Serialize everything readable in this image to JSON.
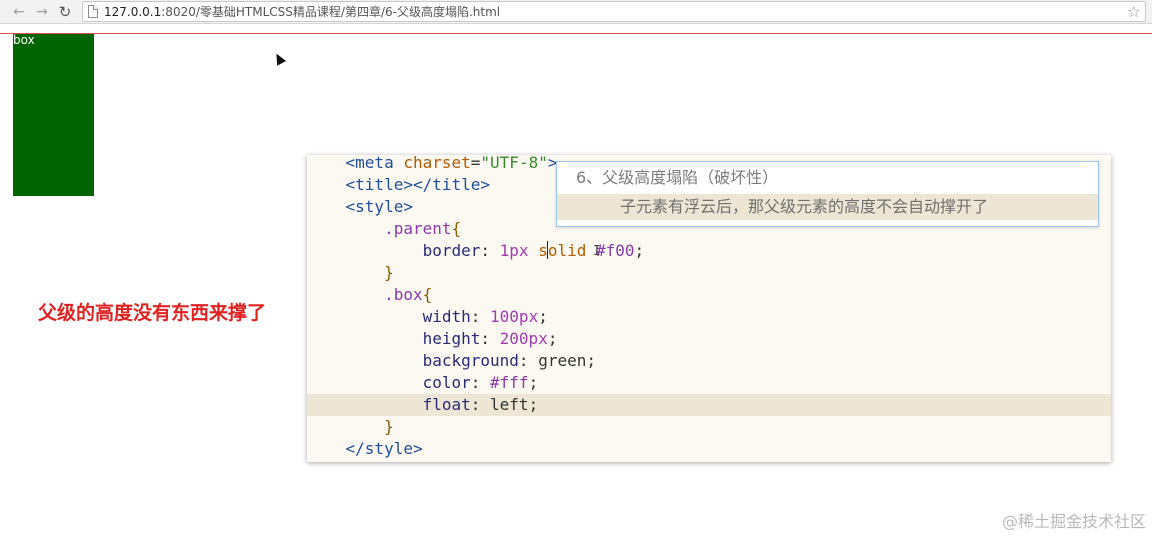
{
  "browser": {
    "url_host": "127.0.0.1",
    "url_path": ":8020/零基础HTMLCSS精品课程/第四章/6-父级高度塌陷.html",
    "icons": {
      "back": "back-arrow-icon",
      "forward": "forward-arrow-icon",
      "reload": "reload-icon",
      "page": "page-icon",
      "bookmark": "star-icon"
    }
  },
  "page": {
    "box_label": "box",
    "box_color": "#006400",
    "parent_border_color": "#ff0000"
  },
  "annotation": {
    "text": "父级的高度没有东西来撑了",
    "color": "#e02222"
  },
  "editor": {
    "lines": [
      {
        "indent": "    ",
        "parts": [
          [
            "tag",
            "<meta "
          ],
          [
            "attr",
            "charset"
          ],
          [
            "plain",
            "="
          ],
          [
            "str",
            "\"UTF-8\""
          ],
          [
            "tag",
            ">"
          ]
        ]
      },
      {
        "indent": "    ",
        "parts": [
          [
            "tag",
            "<title></title>"
          ]
        ]
      },
      {
        "indent": "    ",
        "parts": [
          [
            "tag",
            "<style>"
          ]
        ]
      },
      {
        "indent": "        ",
        "parts": [
          [
            "sel",
            ".parent"
          ],
          [
            "punct",
            "{"
          ]
        ]
      },
      {
        "indent": "            ",
        "parts": [
          [
            "prop",
            "border"
          ],
          [
            "plain",
            ": "
          ],
          [
            "num",
            "1px"
          ],
          [
            "plain",
            " "
          ],
          [
            "kw",
            "solid"
          ],
          [
            "plain",
            " "
          ],
          [
            "sel",
            "#f00"
          ],
          [
            "plain",
            ";"
          ]
        ]
      },
      {
        "indent": "        ",
        "parts": [
          [
            "punct",
            "}"
          ]
        ]
      },
      {
        "indent": "        ",
        "parts": [
          [
            "sel",
            ".box"
          ],
          [
            "punct",
            "{"
          ]
        ]
      },
      {
        "indent": "            ",
        "parts": [
          [
            "prop",
            "width"
          ],
          [
            "plain",
            ": "
          ],
          [
            "num",
            "100px"
          ],
          [
            "plain",
            ";"
          ]
        ]
      },
      {
        "indent": "            ",
        "parts": [
          [
            "prop",
            "height"
          ],
          [
            "plain",
            ": "
          ],
          [
            "num",
            "200px"
          ],
          [
            "plain",
            ";"
          ]
        ]
      },
      {
        "indent": "            ",
        "parts": [
          [
            "prop",
            "background"
          ],
          [
            "plain",
            ": green;"
          ]
        ]
      },
      {
        "indent": "            ",
        "parts": [
          [
            "prop",
            "color"
          ],
          [
            "plain",
            ": "
          ],
          [
            "sel",
            "#fff"
          ],
          [
            "plain",
            ";"
          ]
        ]
      },
      {
        "indent": "            ",
        "parts": [
          [
            "prop",
            "float"
          ],
          [
            "plain",
            ": left;"
          ]
        ]
      },
      {
        "indent": "        ",
        "parts": [
          [
            "punct",
            "}"
          ]
        ]
      },
      {
        "indent": "    ",
        "parts": [
          [
            "tag",
            "</style>"
          ]
        ]
      }
    ],
    "active_line": 11
  },
  "popup": {
    "title": "6、父级高度塌陷（破坏性）",
    "subtitle": "子元素有浮云后，那父级元素的高度不会自动撑开了"
  },
  "watermark": "@稀土掘金技术社区"
}
